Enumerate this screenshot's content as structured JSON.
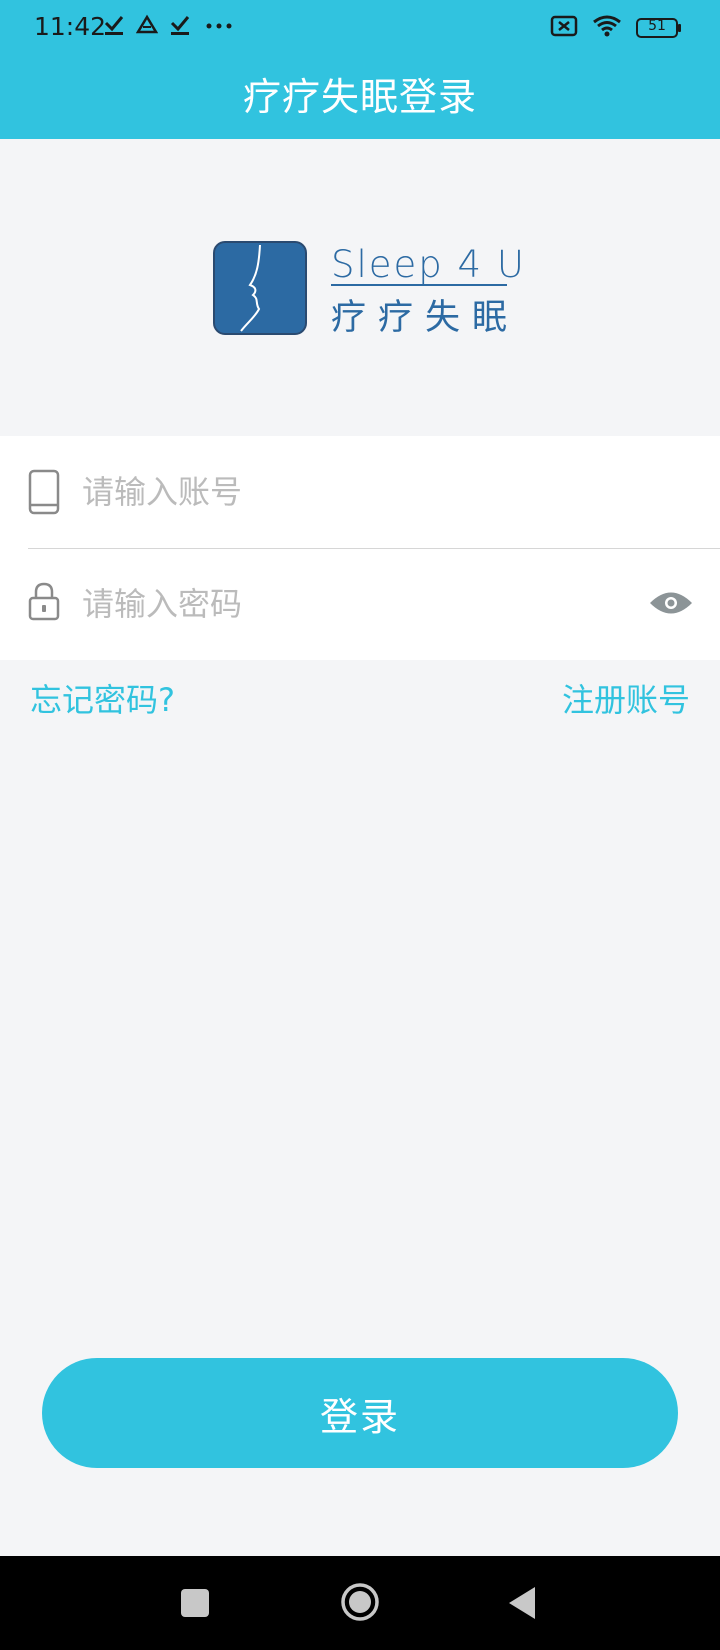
{
  "status_bar": {
    "time": "11:42",
    "battery": "51",
    "icons": [
      "check-icon",
      "drive-icon",
      "check-icon",
      "more-dots-icon",
      "sim-blocked-icon",
      "wifi-icon",
      "battery-icon"
    ]
  },
  "header": {
    "title": "疗疗失眠登录"
  },
  "brand": {
    "name_en": "Sleep 4 U",
    "name_cn": "疗疗失眠"
  },
  "form": {
    "account_placeholder": "请输入账号",
    "password_placeholder": "请输入密码"
  },
  "links": {
    "forgot": "忘记密码?",
    "register": "注册账号"
  },
  "login_button": "登录",
  "colors": {
    "accent": "#31c3df",
    "brand": "#2c6aa3",
    "background": "#f4f5f7"
  },
  "nav_bar": {
    "icons": [
      "recents-square-icon",
      "home-circle-icon",
      "back-triangle-icon"
    ]
  }
}
